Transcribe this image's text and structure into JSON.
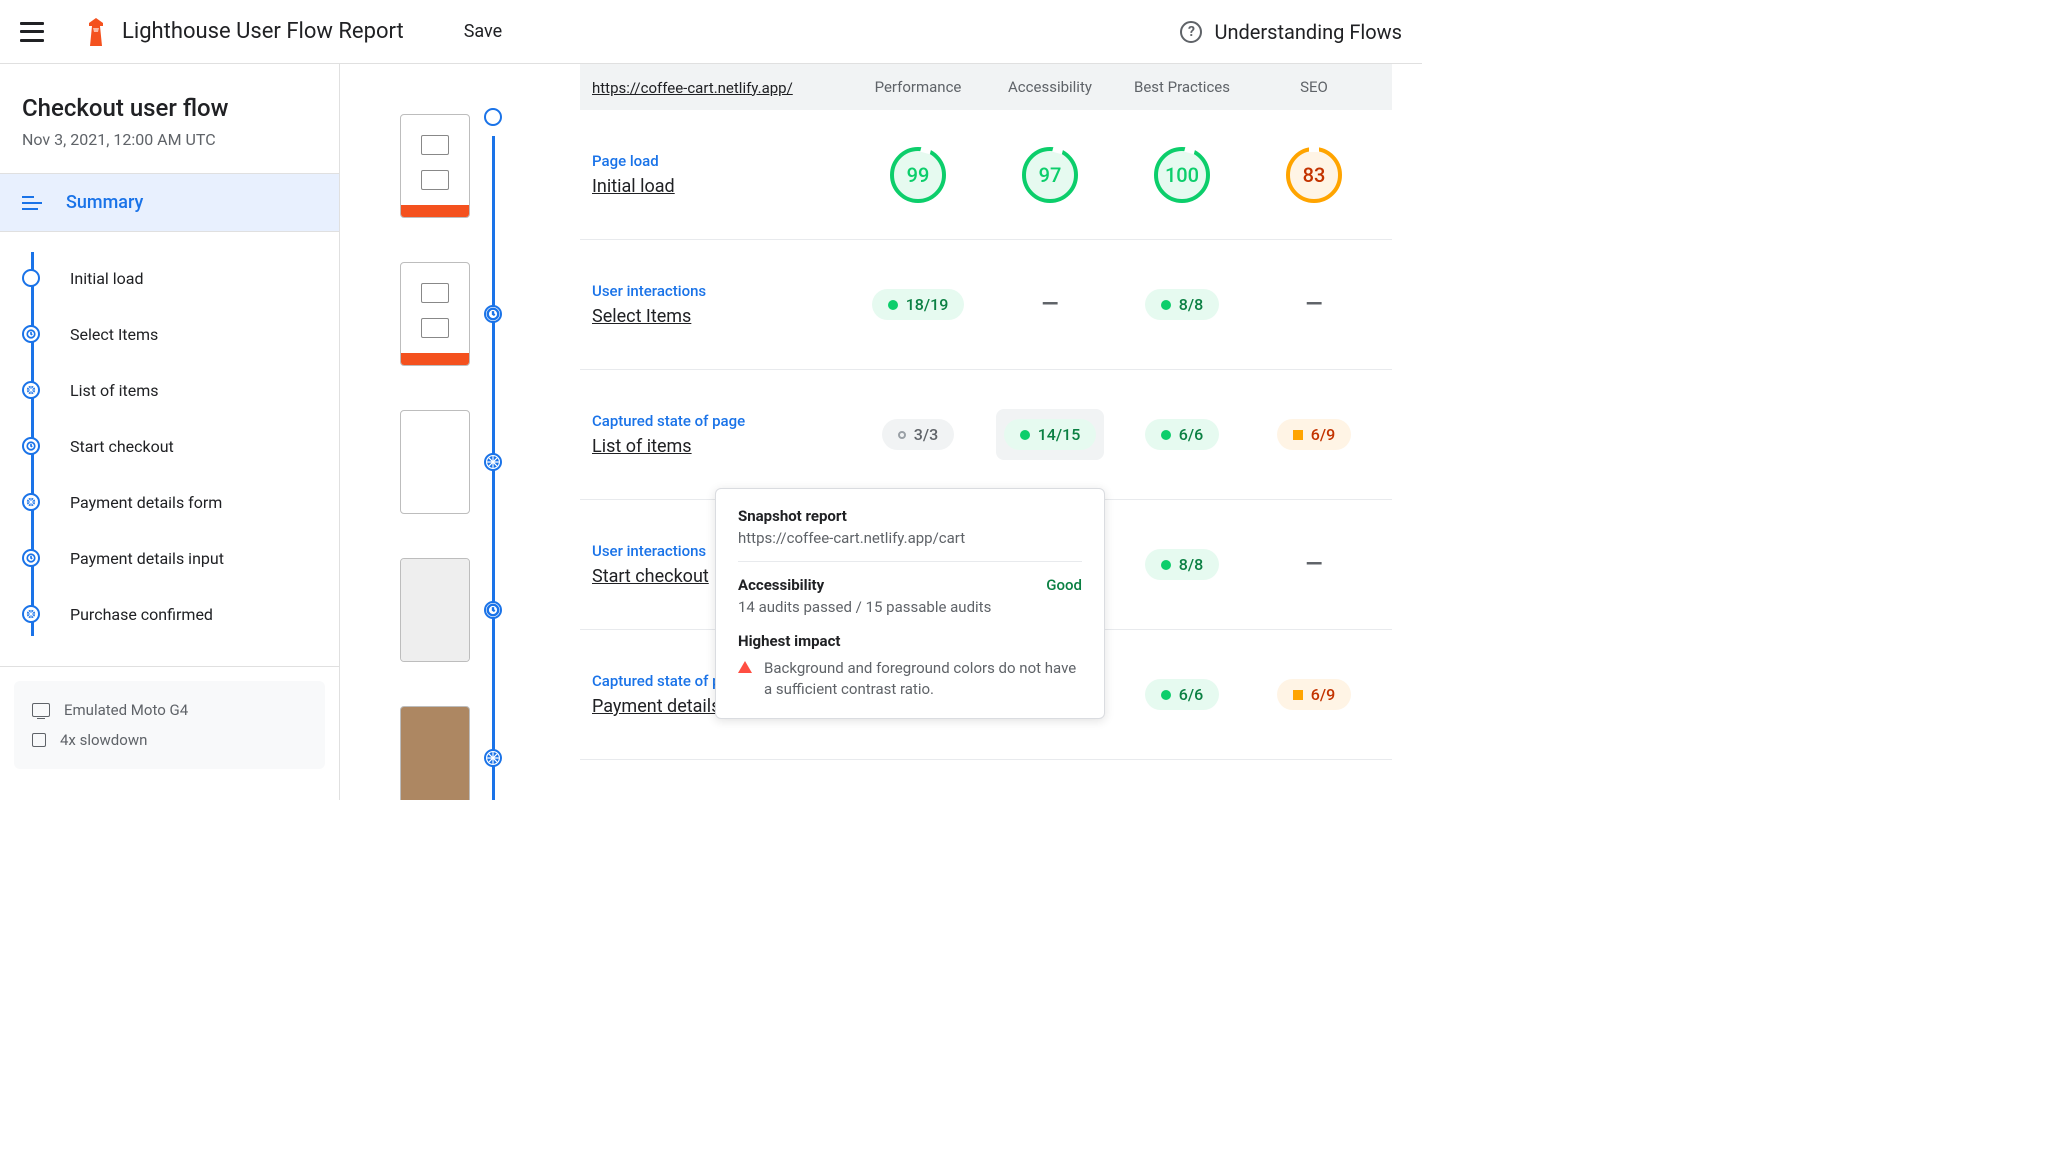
{
  "header": {
    "app_title": "Lighthouse User Flow Report",
    "save": "Save",
    "understanding": "Understanding Flows"
  },
  "sidebar": {
    "title": "Checkout user flow",
    "date": "Nov 3, 2021, 12:00 AM UTC",
    "summary": "Summary",
    "steps": [
      {
        "label": "Initial load",
        "type": "nav"
      },
      {
        "label": "Select Items",
        "type": "time"
      },
      {
        "label": "List of items",
        "type": "snap"
      },
      {
        "label": "Start checkout",
        "type": "time"
      },
      {
        "label": "Payment details form",
        "type": "snap"
      },
      {
        "label": "Payment details input",
        "type": "time"
      },
      {
        "label": "Purchase confirmed",
        "type": "snap"
      }
    ],
    "env": {
      "device": "Emulated Moto G4",
      "cpu": "4x slowdown"
    }
  },
  "report": {
    "url": "https://coffee-cart.netlify.app/",
    "cols": [
      "Performance",
      "Accessibility",
      "Best Practices",
      "SEO"
    ],
    "rows": [
      {
        "type": "Page load",
        "name": "Initial load",
        "scores": [
          {
            "kind": "gauge",
            "value": "99",
            "cls": "green"
          },
          {
            "kind": "gauge",
            "value": "97",
            "cls": "green"
          },
          {
            "kind": "gauge",
            "value": "100",
            "cls": "green"
          },
          {
            "kind": "gauge",
            "value": "83",
            "cls": "orange"
          }
        ]
      },
      {
        "type": "User interactions",
        "name": "Select Items",
        "scores": [
          {
            "kind": "chip",
            "value": "18/19",
            "cls": "green",
            "icon": "dot"
          },
          {
            "kind": "dash"
          },
          {
            "kind": "chip",
            "value": "8/8",
            "cls": "green",
            "icon": "dot"
          },
          {
            "kind": "dash"
          }
        ]
      },
      {
        "type": "Captured state of page",
        "name": "List of items",
        "scores": [
          {
            "kind": "chip",
            "value": "3/3",
            "cls": "grey",
            "icon": "hollow"
          },
          {
            "kind": "chip",
            "value": "14/15",
            "cls": "green",
            "icon": "dot",
            "hl": true
          },
          {
            "kind": "chip",
            "value": "6/6",
            "cls": "green",
            "icon": "dot"
          },
          {
            "kind": "chip",
            "value": "6/9",
            "cls": "orange",
            "icon": "sq"
          }
        ]
      },
      {
        "type": "User interactions",
        "name": "Start checkout",
        "scores": [
          {
            "kind": "blank"
          },
          {
            "kind": "blank"
          },
          {
            "kind": "chip",
            "value": "8/8",
            "cls": "green",
            "icon": "dot"
          },
          {
            "kind": "dash"
          }
        ]
      },
      {
        "type": "Captured state of page",
        "name": "Payment details form",
        "scores": [
          {
            "kind": "blank"
          },
          {
            "kind": "blank"
          },
          {
            "kind": "chip",
            "value": "6/6",
            "cls": "green",
            "icon": "dot"
          },
          {
            "kind": "chip",
            "value": "6/9",
            "cls": "orange",
            "icon": "sq"
          }
        ]
      }
    ]
  },
  "tooltip": {
    "title": "Snapshot report",
    "url": "https://coffee-cart.netlify.app/cart",
    "category": "Accessibility",
    "status": "Good",
    "detail": "14 audits passed / 15 passable audits",
    "impact_title": "Highest impact",
    "impact_text": "Background and foreground colors do not have a sufficient contrast ratio."
  }
}
